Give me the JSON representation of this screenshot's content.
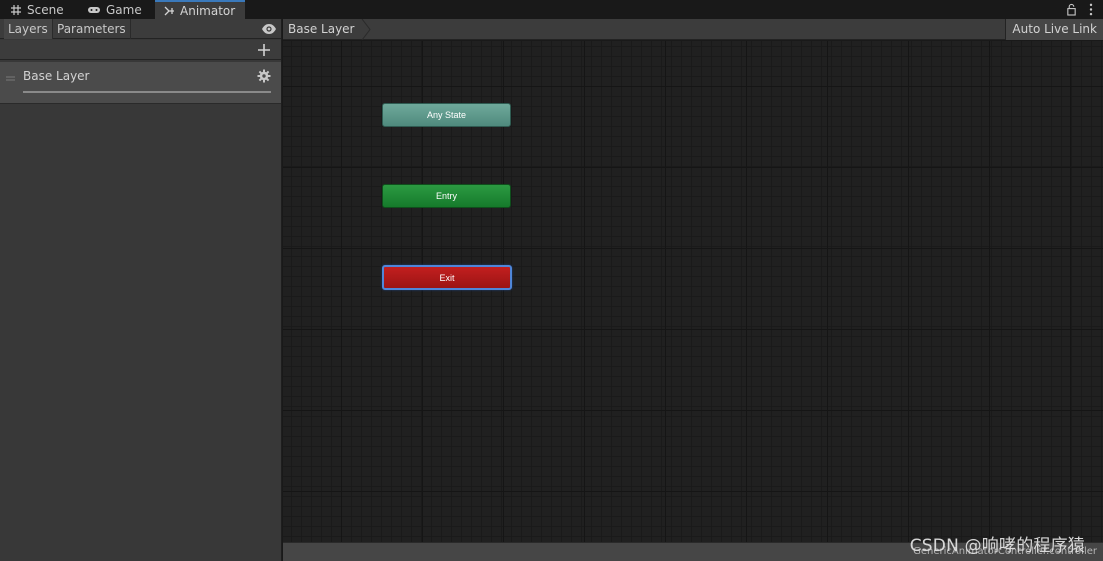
{
  "tabs": [
    {
      "label": "Scene",
      "icon": "grid-icon"
    },
    {
      "label": "Game",
      "icon": "gamepad-icon"
    },
    {
      "label": "Animator",
      "icon": "animator-icon",
      "active": true
    }
  ],
  "window_controls": [
    "lock-icon",
    "more-vertical-icon"
  ],
  "left_panel": {
    "tabs": [
      "Layers",
      "Parameters"
    ],
    "visibility_icon": "eye-icon",
    "add_icon": "plus-icon",
    "layers": [
      {
        "name": "Base Layer",
        "settings_icon": "gear-icon"
      }
    ]
  },
  "graph": {
    "breadcrumb": "Base Layer",
    "auto_live_link": "Auto Live Link",
    "states": [
      {
        "label": "Any State",
        "color": "#5e9a8c"
      },
      {
        "label": "Entry",
        "color": "#1f8a35"
      },
      {
        "label": "Exit",
        "color": "#b01a1a",
        "selected": true
      }
    ],
    "asset_path": "GenericAnimatorController.controller"
  },
  "colors": {
    "accent": "#3a79bb",
    "selection_outline": "#4f86d9"
  },
  "watermark": "CSDN @响哮的程序猿"
}
